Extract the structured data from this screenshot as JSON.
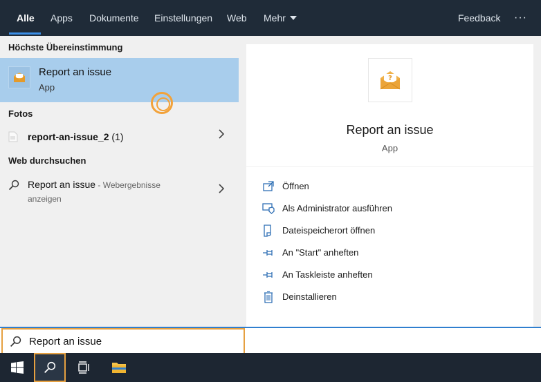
{
  "nav": {
    "tabs": [
      {
        "label": "Alle",
        "active": true
      },
      {
        "label": "Apps"
      },
      {
        "label": "Dokumente"
      },
      {
        "label": "Einstellungen"
      },
      {
        "label": "Web"
      },
      {
        "label": "Mehr"
      }
    ],
    "feedback_label": "Feedback",
    "more_options": "···"
  },
  "results": {
    "best_match_heading": "Höchste Übereinstimmung",
    "best_match": {
      "title": "Report an issue",
      "subtitle": "App"
    },
    "photos_heading": "Fotos",
    "photo_item": {
      "name": "report-an-issue_2",
      "suffix": " (1)"
    },
    "web_heading": "Web durchsuchen",
    "web_item": {
      "query": "Report an issue",
      "suffix": " - Webergebnisse",
      "line2": "anzeigen"
    }
  },
  "preview": {
    "title": "Report an issue",
    "subtitle": "App",
    "actions": [
      {
        "label": "Öffnen",
        "icon": "open-icon"
      },
      {
        "label": "Als Administrator ausführen",
        "icon": "shield-admin-icon"
      },
      {
        "label": "Dateispeicherort öffnen",
        "icon": "file-location-icon"
      },
      {
        "label": "An \"Start\" anheften",
        "icon": "pin-icon"
      },
      {
        "label": "An Taskleiste anheften",
        "icon": "pin-icon"
      },
      {
        "label": "Deinstallieren",
        "icon": "trash-icon"
      }
    ]
  },
  "search": {
    "value": "Report an issue"
  },
  "colors": {
    "accent": "#3a8ee6",
    "selection": "#a8cdec",
    "focus": "#e6a040",
    "nav_bg": "#1f2b38"
  }
}
